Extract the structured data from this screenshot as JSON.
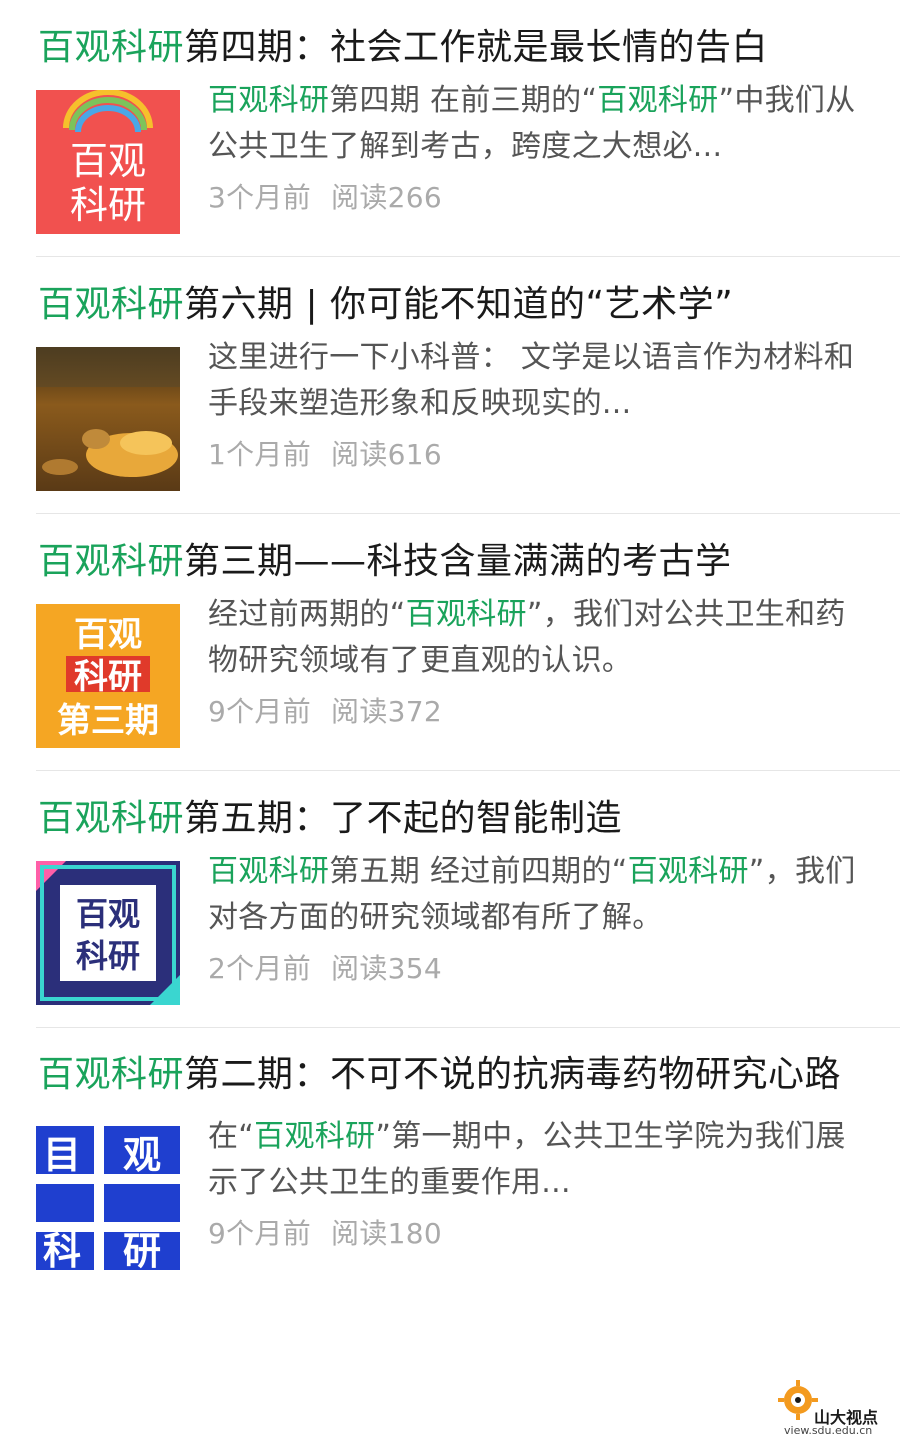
{
  "articles": [
    {
      "title_prefix": "百观科研",
      "title_rest": "第四期：社会工作就是最长情的告白",
      "desc_parts": [
        {
          "text": "百观科研",
          "hl": true
        },
        {
          "text": "第四期 在前三期的“",
          "hl": false
        },
        {
          "text": "百观科研",
          "hl": true
        },
        {
          "text": "”中我们从公共卫生了解到考古，跨度之大想必...",
          "hl": false
        }
      ],
      "time": "3个月前",
      "reads": "阅读266",
      "thumb_text": [
        "百观",
        "科研"
      ]
    },
    {
      "title_prefix": "百观科研",
      "title_rest": "第六期 | 你可能不知道的“艺术学”",
      "desc_parts": [
        {
          "text": "这里进行一下小科普： 文学是以语言作为材料和手段来塑造形象和反映现实的...",
          "hl": false
        }
      ],
      "time": "1个月前",
      "reads": "阅读616",
      "thumb_text": []
    },
    {
      "title_prefix": "百观科研",
      "title_rest": "第三期——科技含量满满的考古学",
      "desc_parts": [
        {
          "text": "经过前两期的“",
          "hl": false
        },
        {
          "text": "百观科研",
          "hl": true
        },
        {
          "text": "”，我们对公共卫生和药物研究领域有了更直观的认识。",
          "hl": false
        }
      ],
      "time": "9个月前",
      "reads": "阅读372",
      "thumb_text": [
        "百观",
        "科研",
        "第三期"
      ]
    },
    {
      "title_prefix": "百观科研",
      "title_rest": "第五期：了不起的智能制造",
      "desc_parts": [
        {
          "text": "百观科研",
          "hl": true
        },
        {
          "text": "第五期 经过前四期的“",
          "hl": false
        },
        {
          "text": "百观科研",
          "hl": true
        },
        {
          "text": "”，我们对各方面的研究领域都有所了解。",
          "hl": false
        }
      ],
      "time": "2个月前",
      "reads": "阅读354",
      "thumb_text": [
        "百观",
        "科研"
      ]
    },
    {
      "title_prefix": "百观科研",
      "title_rest": "第二期：不可不说的抗病毒药物研究心路",
      "desc_parts": [
        {
          "text": "在“",
          "hl": false
        },
        {
          "text": "百观科研",
          "hl": true
        },
        {
          "text": "”第一期中，公共卫生学院为我们展示了公共卫生的重要作用...",
          "hl": false
        }
      ],
      "time": "9个月前",
      "reads": "阅读180",
      "thumb_text": [
        "目",
        "观",
        "科",
        "研"
      ]
    }
  ],
  "watermark": {
    "name": "山大视点",
    "url": "view.sdu.edu.cn"
  },
  "colors": {
    "highlight": "#1aa35b",
    "meta": "#aaaaaa"
  }
}
